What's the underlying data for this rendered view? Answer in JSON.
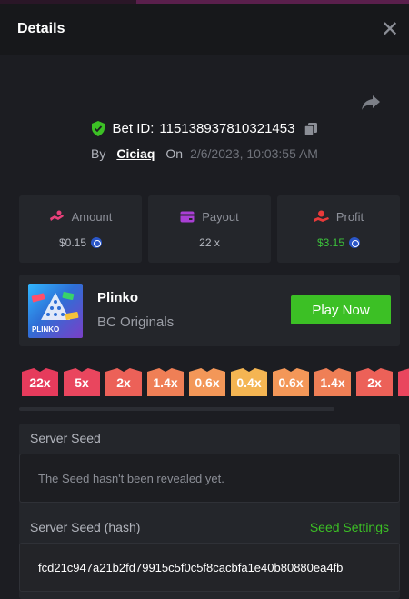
{
  "header": {
    "title": "Details"
  },
  "bet": {
    "id_label": "Bet ID:",
    "id": "115138937810321453",
    "by_label": "By",
    "user": "Ciciaq",
    "on_label": "On",
    "datetime": "2/6/2023, 10:03:55 AM"
  },
  "stats": [
    {
      "label": "Amount",
      "value": "$0.15",
      "icon": "amount-icon",
      "color": "#e8407a"
    },
    {
      "label": "Payout",
      "value": "22 x",
      "icon": "payout-icon",
      "color": "#a93fd4"
    },
    {
      "label": "Profit",
      "value": "$3.15",
      "icon": "profit-icon",
      "color": "#e83a3a"
    }
  ],
  "game": {
    "name": "Plinko",
    "provider": "BC Originals",
    "thumb_label": "PLINKO",
    "play_label": "Play Now"
  },
  "multipliers": [
    {
      "label": "22x",
      "color": "#e63b5c"
    },
    {
      "label": "5x",
      "color": "#e9465e"
    },
    {
      "label": "2x",
      "color": "#ec6158"
    },
    {
      "label": "1.4x",
      "color": "#ef7f56"
    },
    {
      "label": "0.6x",
      "color": "#f39758"
    },
    {
      "label": "0.4x",
      "color": "#f4b552"
    },
    {
      "label": "0.6x",
      "color": "#f39758"
    },
    {
      "label": "1.4x",
      "color": "#ef7f56"
    },
    {
      "label": "2x",
      "color": "#ec6158"
    }
  ],
  "seeds": {
    "server_seed_label": "Server Seed",
    "server_seed_value": "The Seed hasn't been revealed yet.",
    "server_hash_label": "Server Seed (hash)",
    "settings_link": "Seed Settings",
    "server_hash_value": "fcd21c947a21b2fd79915c5f0c5f8cacbfa1e40b80880ea4fb"
  },
  "colors": {
    "accent_green": "#3cc025",
    "background": "#1c1d22",
    "panel": "#24262b"
  }
}
